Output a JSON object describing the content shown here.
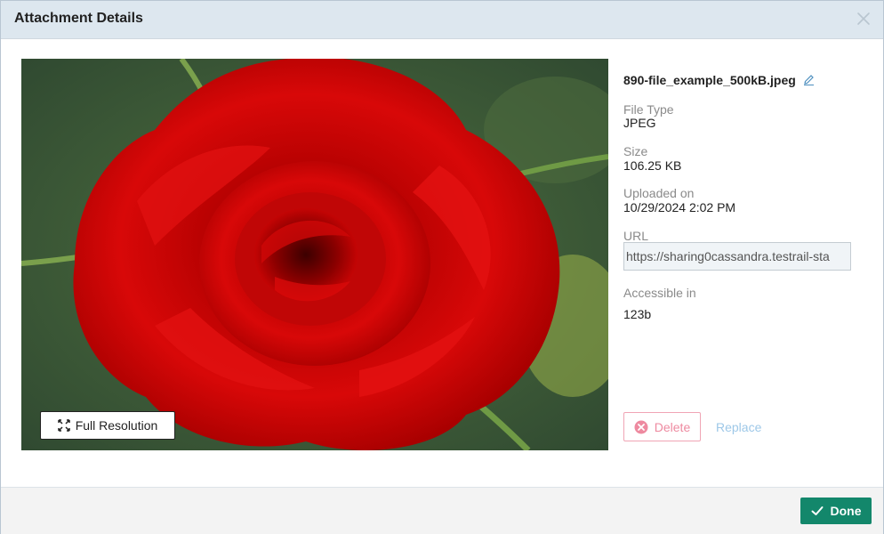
{
  "dialog": {
    "title": "Attachment Details",
    "close_icon": "close-icon"
  },
  "preview": {
    "full_resolution_label": "Full Resolution",
    "expand_icon": "expand-arrows-icon"
  },
  "info": {
    "filename": "890-file_example_500kB.jpeg",
    "edit_icon": "pencil-icon",
    "file_type_label": "File Type",
    "file_type_value": "JPEG",
    "size_label": "Size",
    "size_value": "106.25 KB",
    "uploaded_label": "Uploaded on",
    "uploaded_value": "10/29/2024 2:02 PM",
    "url_label": "URL",
    "url_value": "https://sharing0cassandra.testrail-sta",
    "accessible_label": "Accessible in",
    "accessible_value": "123b"
  },
  "actions": {
    "delete_label": "Delete",
    "delete_icon": "x-circle-icon",
    "replace_label": "Replace"
  },
  "footer": {
    "done_label": "Done",
    "done_icon": "check-icon"
  },
  "colors": {
    "header_bg": "#dde7ef",
    "done_green": "#13876b",
    "delete_pink": "#ee8aa0",
    "replace_blue": "#9ec8e8"
  }
}
